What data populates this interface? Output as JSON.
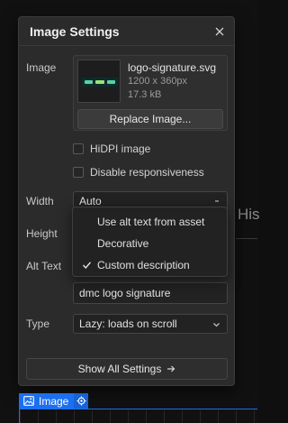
{
  "canvas": {
    "heading_fragment": "His"
  },
  "panel": {
    "title": "Image Settings",
    "image": {
      "label": "Image",
      "file_name": "logo-signature.svg",
      "dimensions": "1200 x 360px",
      "file_size": "17.3 kB",
      "replace_label": "Replace Image..."
    },
    "hidpi_label": "HiDPI image",
    "hidpi_checked": false,
    "disable_responsive_label": "Disable responsiveness",
    "disable_responsive_checked": false,
    "width": {
      "label": "Width",
      "value": "Auto"
    },
    "height": {
      "label": "Height"
    },
    "alt_text": {
      "label": "Alt Text",
      "menu_items": [
        {
          "label": "Use alt text from asset",
          "selected": false
        },
        {
          "label": "Decorative",
          "selected": false
        },
        {
          "label": "Custom description",
          "selected": true
        }
      ],
      "value": "dmc logo signature"
    },
    "type": {
      "label": "Type",
      "value": "Lazy: loads on scroll"
    },
    "show_all_label": "Show All Settings"
  },
  "element_tag": {
    "label": "Image",
    "color": "#1b6ff0"
  },
  "icons": {
    "close": "close-icon",
    "arrow_right": "arrow-right-icon",
    "image": "image-icon",
    "gear": "gear-icon",
    "chevron": "chevron-down-icon",
    "check": "checkmark-icon"
  }
}
